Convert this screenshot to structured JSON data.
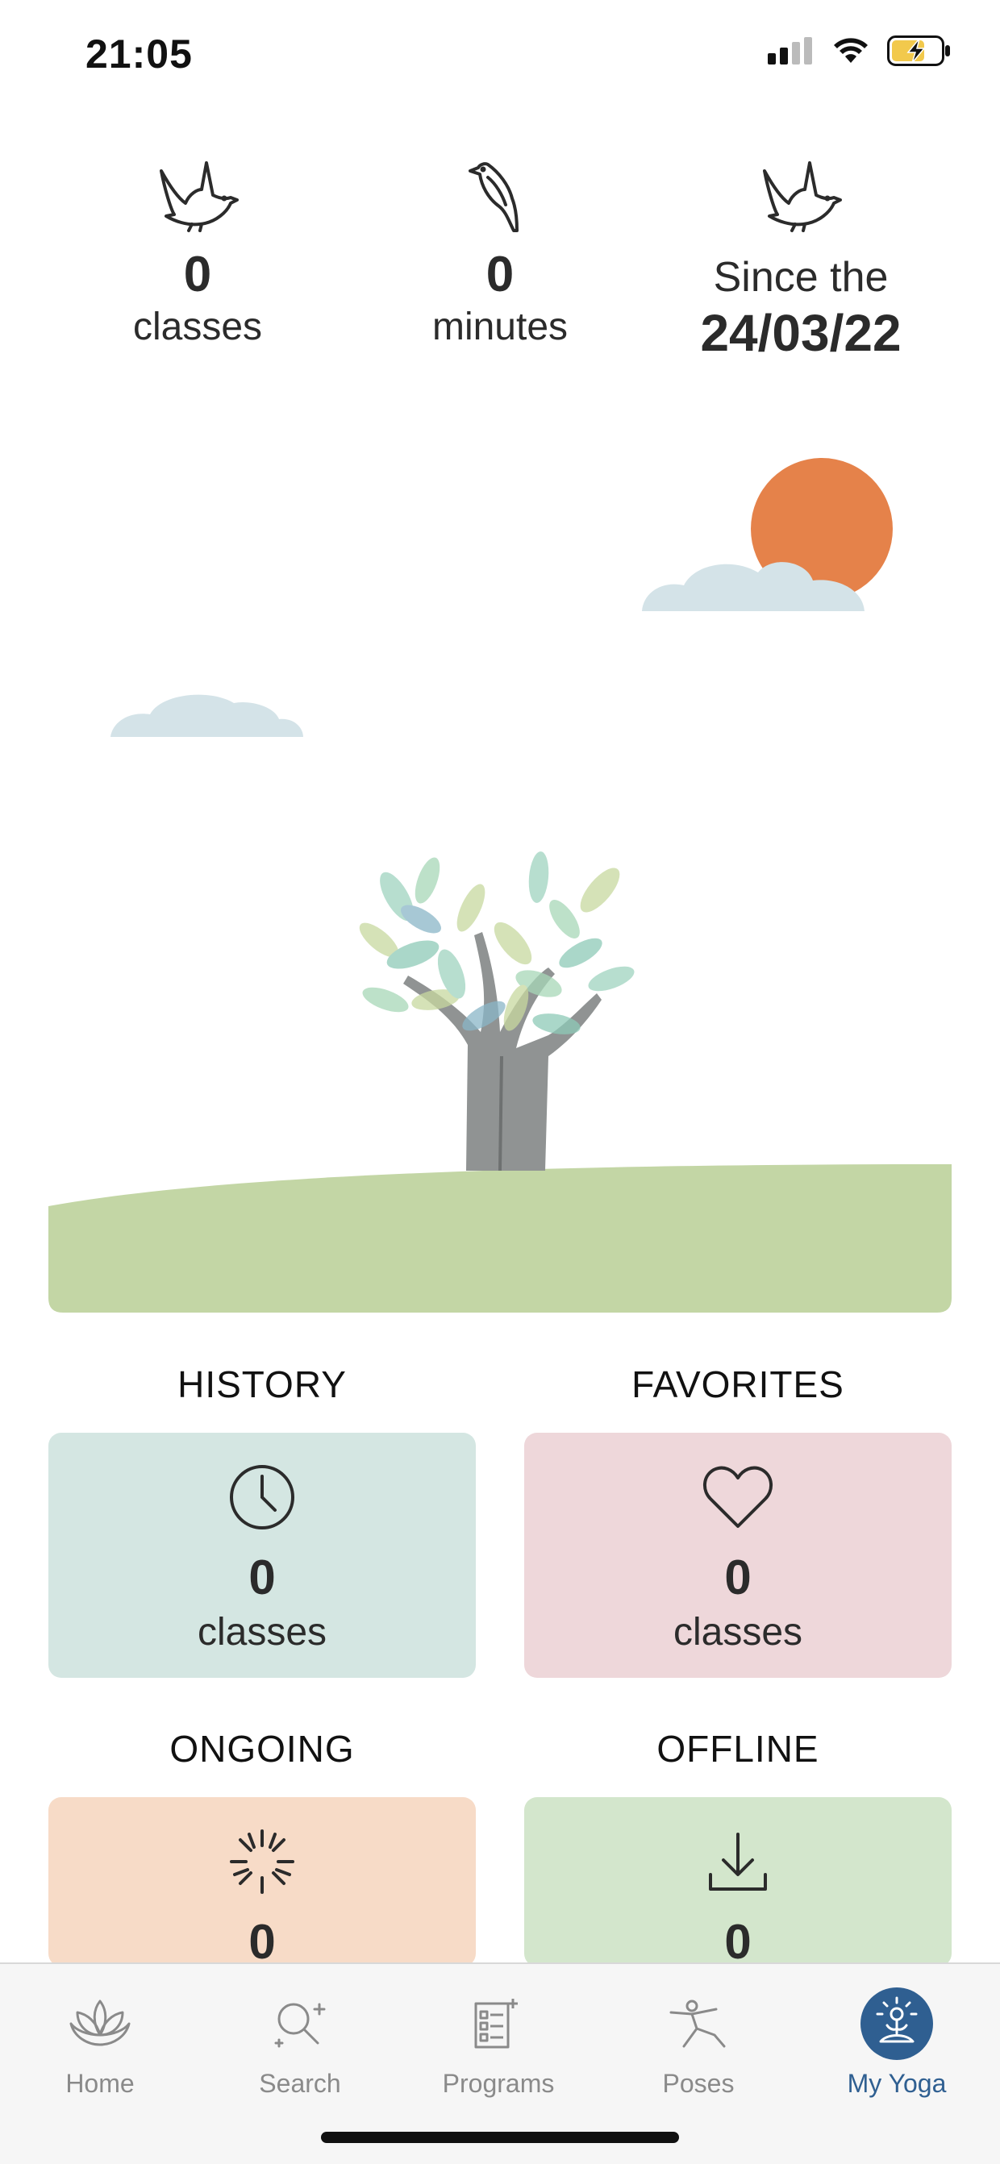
{
  "status_bar": {
    "time": "21:05"
  },
  "stats": {
    "classes_count": "0",
    "classes_label": "classes",
    "minutes_count": "0",
    "minutes_label": "minutes",
    "since_label": "Since the",
    "since_date": "24/03/22"
  },
  "sections": {
    "history": {
      "title": "HISTORY",
      "count": "0",
      "label": "classes",
      "color": "#d4e6e2"
    },
    "favorites": {
      "title": "FAVORITES",
      "count": "0",
      "label": "classes",
      "color": "#eed7da"
    },
    "ongoing": {
      "title": "ONGOING",
      "count": "0",
      "color": "#f7dbc7"
    },
    "offline": {
      "title": "OFFLINE",
      "count": "0",
      "color": "#d3e6cc"
    }
  },
  "tab_bar": {
    "items": [
      {
        "label": "Home",
        "icon": "lotus-icon"
      },
      {
        "label": "Search",
        "icon": "search-sparkle-icon"
      },
      {
        "label": "Programs",
        "icon": "programs-list-icon"
      },
      {
        "label": "Poses",
        "icon": "yoga-pose-icon"
      },
      {
        "label": "My Yoga",
        "icon": "meditation-avatar-icon",
        "active": true
      }
    ],
    "active_color": "#2f5f91"
  }
}
